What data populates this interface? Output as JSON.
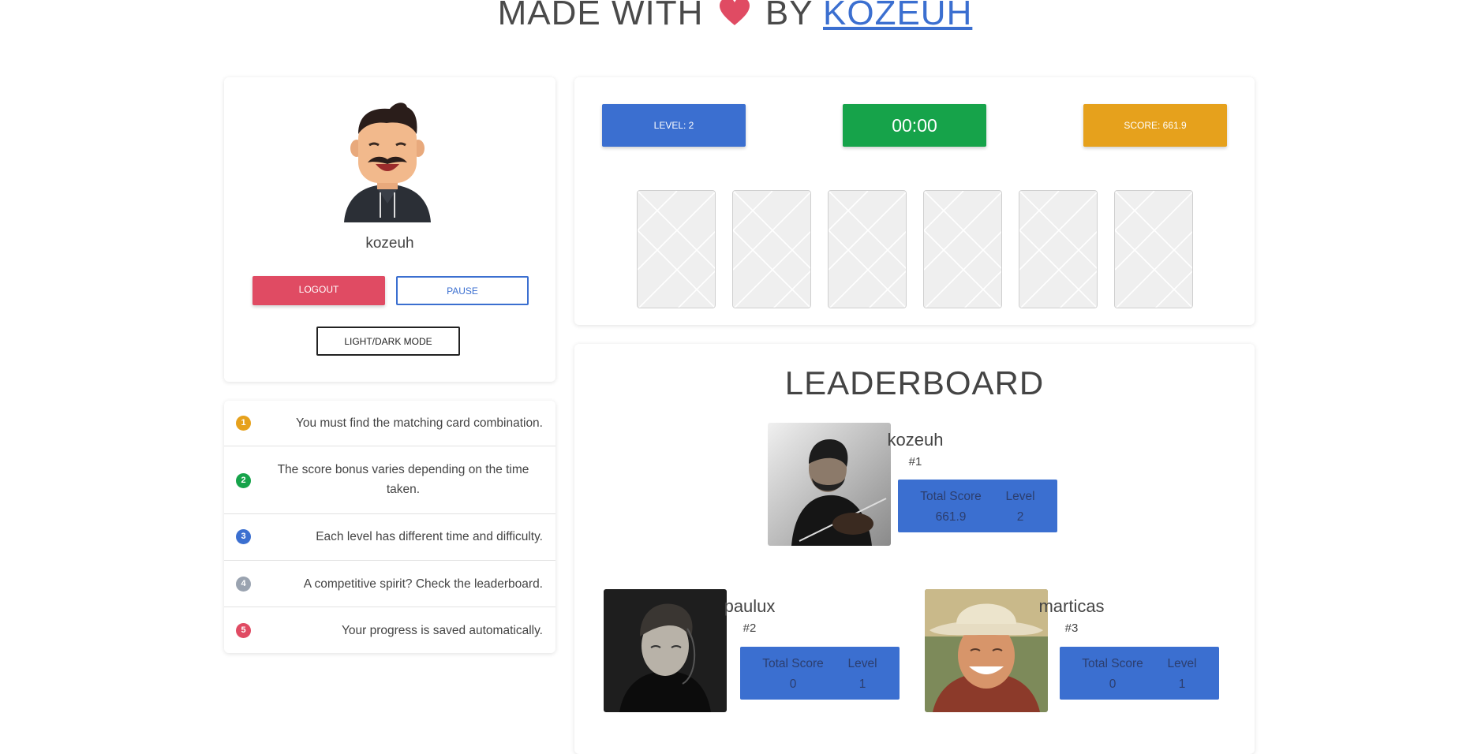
{
  "header": {
    "prefix": "MADE WITH",
    "by": "BY",
    "author": "KOZEUH",
    "heart_color": "#e04b63"
  },
  "profile": {
    "username": "kozeuh",
    "logout_label": "LOGOUT",
    "pause_label": "PAUSE",
    "mode_label": "LIGHT/DARK MODE"
  },
  "rules": [
    {
      "number": "1",
      "text": "You must find the matching card combination.",
      "color": "#e6a11c"
    },
    {
      "number": "2",
      "text": "The score bonus varies depending on the time taken.",
      "color": "#16a34a"
    },
    {
      "number": "3",
      "text": "Each level has different time and difficulty.",
      "color": "#3b6fd0"
    },
    {
      "number": "4",
      "text": "A competitive spirit? Check the leaderboard.",
      "color": "#9aa3b0"
    },
    {
      "number": "5",
      "text": "Your progress is saved automatically.",
      "color": "#e04b63"
    }
  ],
  "game": {
    "level_label": "LEVEL: 2",
    "timer": "00:00",
    "score_label": "SCORE: 661.9",
    "card_count": 6
  },
  "leaderboard": {
    "title": "LEADERBOARD",
    "total_score_label": "Total Score",
    "level_label": "Level",
    "entries": [
      {
        "name": "kozeuh",
        "rank": "#1",
        "score": "661.9",
        "level": "2"
      },
      {
        "name": "paulux",
        "rank": "#2",
        "score": "0",
        "level": "1"
      },
      {
        "name": "marticas",
        "rank": "#3",
        "score": "0",
        "level": "1"
      }
    ]
  }
}
